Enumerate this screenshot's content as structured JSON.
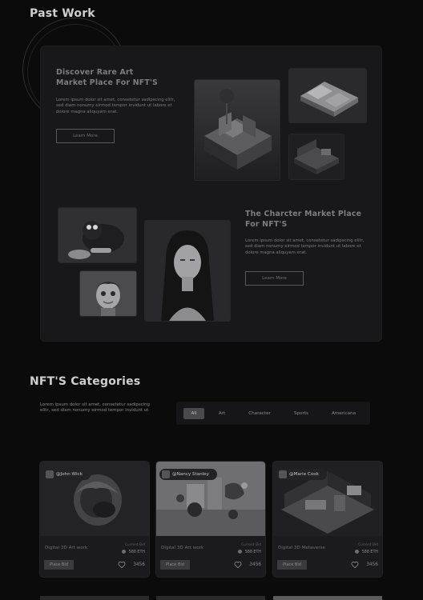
{
  "past_work": {
    "title": "Past Work",
    "feature1": {
      "title_line1": "Discover Rare Art",
      "title_line2": "Market Place For NFT'S",
      "body_line1": "Lorem ipsum dolor sit amet, consetetur sadipscing elitr,",
      "body_line2": "sed diam nonumy eirmod tempor invidunt ut labore et",
      "body_line3": "dolore magna aliquyam erat.",
      "button": "Learn More"
    },
    "feature2": {
      "title_line1": "The Charcter Market Place",
      "title_line2": "For NFT'S",
      "body_line1": "Lorem ipsum dolor sit amet, consetetur sadipscing elitr,",
      "body_line2": "sed diam nonumy eirmod tempor invidunt ut labore et",
      "body_line3": "dolore magna aliquyam erat.",
      "button": "Learn More"
    }
  },
  "categories": {
    "title": "NFT'S Categories",
    "desc_line1": "Lorem ipsum dolor sit amet, consetetur sadipscing",
    "desc_line2": "elitr, sed diam nonumy eirmod tempor invidunt ut",
    "tabs": [
      "All",
      "Art",
      "Character",
      "Sports",
      "Americana"
    ],
    "active_tab": "All"
  },
  "cards": [
    {
      "user": "@John Wick",
      "title": "Digital 3D Art work",
      "bid_label": "Current Bid",
      "bid": "588 ETH",
      "button": "Place Bid",
      "likes": "3456"
    },
    {
      "user": "@Nancy Stanley",
      "title": "Digital 3D Art work",
      "bid_label": "Current Bid",
      "bid": "588 ETH",
      "button": "Place Bid",
      "likes": "3456"
    },
    {
      "user": "@Marie Cook",
      "title": "Digital 3D Metaverse",
      "bid_label": "Current Bid",
      "bid": "588 ETH",
      "button": "Place Bid",
      "likes": "3456"
    }
  ],
  "icons": {
    "heart": "heart-icon",
    "eth": "eth-coin-icon",
    "avatar": "avatar"
  },
  "colors": {
    "background": "#0b0b0c",
    "panel": "#18181a",
    "card": "#1b1b1d",
    "active_tab": "#4a4a4e"
  }
}
